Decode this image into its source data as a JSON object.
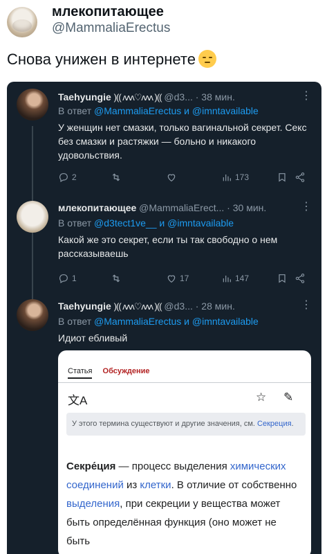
{
  "post": {
    "author_name": "млекопитающее",
    "author_handle": "@MammaliaErectus",
    "text": "Снова унижен в интернете",
    "emoji_icon": "pensive-face-emoji"
  },
  "screenshot": {
    "tweets": [
      {
        "name": "Taehyungie",
        "decor": ")(( ʌʌʌ♡ʌʌʌ )((",
        "meta": "@d3... · 38 мин.",
        "reply_prefix": "В ответ ",
        "reply_user1": "@MammaliaErectus",
        "reply_and": " и ",
        "reply_user2": "@imntavailable",
        "body": "У женщин нет смазки, только вагинальной секрет. Секс без смазки и растяжки — больно и никакого удовольствия.",
        "replies": "2",
        "retweets": "",
        "likes": "",
        "views": "173"
      },
      {
        "name": "млекопитающее",
        "decor": "",
        "meta": "@MammaliaErect... · 30 мин.",
        "reply_prefix": "В ответ ",
        "reply_user1": "@d3tect1ve__",
        "reply_and": " и ",
        "reply_user2": "@imntavailable",
        "body": "Какой же это секрет, если ты так свободно о нем рассказываешь",
        "replies": "1",
        "retweets": "",
        "likes": "17",
        "views": "147"
      },
      {
        "name": "Taehyungie",
        "decor": ")(( ʌʌʌ♡ʌʌʌ )((",
        "meta": "@d3... · 28 мин.",
        "reply_prefix": "В ответ ",
        "reply_user1": "@MammaliaErectus",
        "reply_and": " и ",
        "reply_user2": "@imntavailable",
        "body": "Идиот ебливый"
      }
    ],
    "wiki": {
      "tab_article": "Статья",
      "tab_talk": "Обсуждение",
      "translate_icon": "文A",
      "note": "У этого термина существуют и другие значения, см. ",
      "note_link": "Секреция",
      "note_end": ".",
      "term": "Секре́ция",
      "t1": " — процесс выделения ",
      "l1": "химических соединений",
      "t2": " из ",
      "l2": "клетки",
      "t3": ". В отличие от собственно ",
      "l3": "выделения",
      "t4": ", при секреции у вещества может быть определённая функция (оно может не быть"
    }
  }
}
